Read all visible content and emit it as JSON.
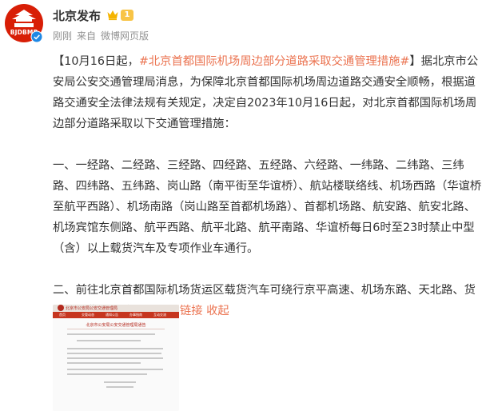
{
  "post": {
    "author": {
      "name": "北京发布",
      "avatar_text": "BJDBMP",
      "level": "1"
    },
    "meta": {
      "time": "刚刚",
      "source_prefix": "来自",
      "source": "微博网页版"
    },
    "content": {
      "lead_bracket_open": "【10月16日起，",
      "topic": "#北京首都国际机场周边部分道路采取交通管理措施#",
      "lead_bracket_close": "】据北京市公安局公安交通管理局消息，为保障北京首都国际机场周边道路交通安全顺畅，根据道路交通安全法律法规有关规定，决定自2023年10月16日起，对北京首都国际机场周边部分道路采取以下交通管理措施：",
      "para1": "一、一经路、二经路、三经路、四经路、五经路、六经路、一纬路、二纬路、三纬路、四纬路、五纬路、岗山路（南平街至华谊桥）、航站楼联络线、机场西路（华谊桥至航平西路）、机场南路（岗山路至首都机场路）、首都机场路、航安路、航安北路、机场宾馆东侧路、航平西路、航平北路、航平南路、华谊桥每日6时至23时禁止中型（含）以上载货汽车及专项作业车通行。",
      "para2": "二、前往北京首都国际机场货运区载货汽车可绕行京平高速、机场东路、天北路、货运路、货运北路。",
      "web_link": "网页链接",
      "collapse": "收起"
    },
    "preview": {
      "brand": "北京市公安局公安交通管理局",
      "nav": [
        "首页",
        "交管动态",
        "通知公告",
        "办事指南",
        "互动交流"
      ],
      "title": "北京市公安局公安交通管理局通告"
    }
  },
  "colors": {
    "accent": "#eb7350",
    "avatar_red": "#d81e06",
    "text": "#333333",
    "meta": "#939393",
    "verified": "#1e88e5",
    "level": "#f8c446"
  }
}
